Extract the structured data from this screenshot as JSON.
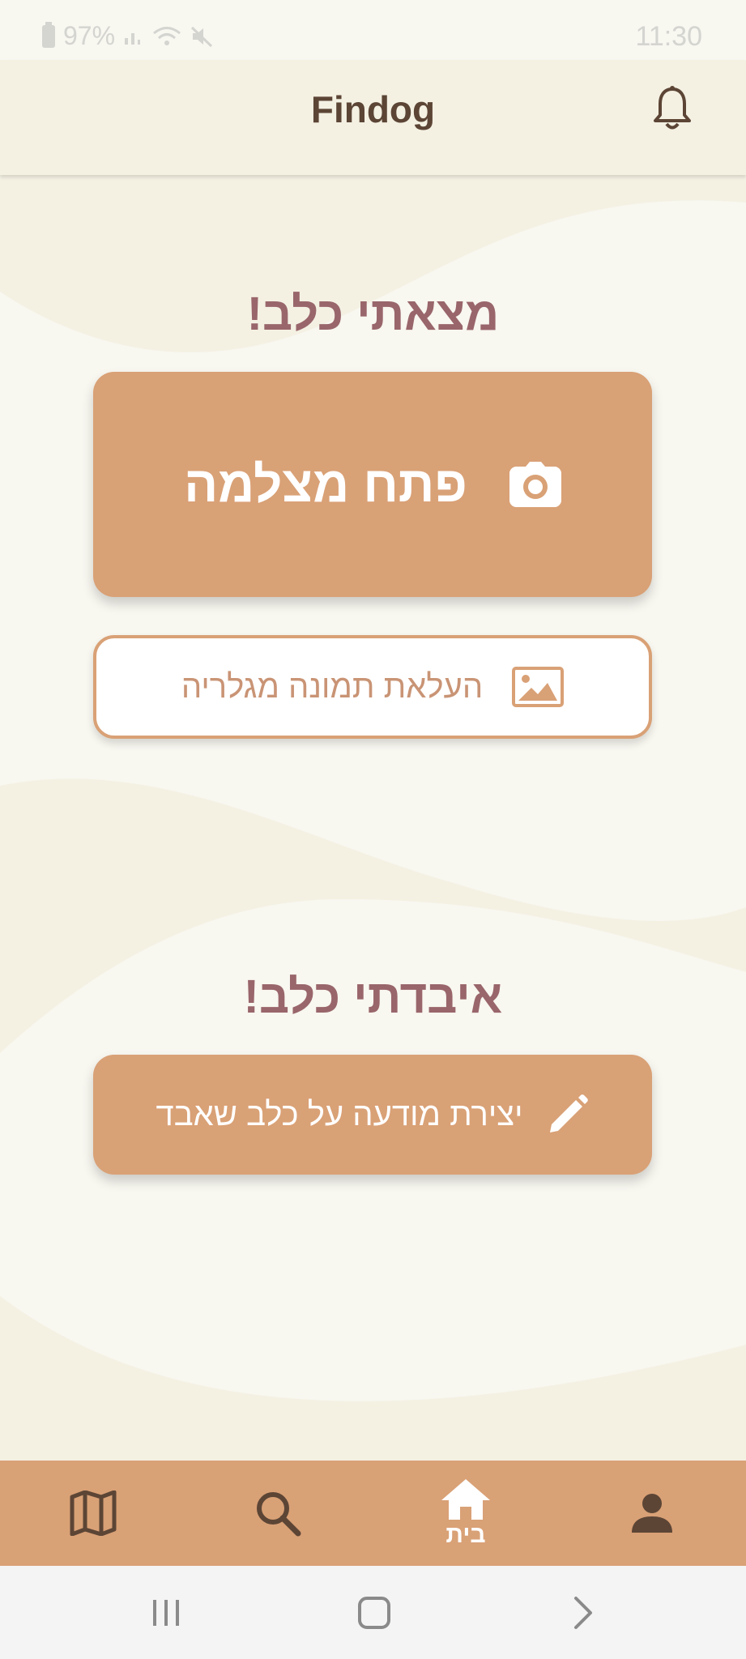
{
  "status_bar": {
    "battery": "97%",
    "time": "11:30"
  },
  "app_bar": {
    "title": "Findog",
    "bell_icon": "bell-icon"
  },
  "found_section": {
    "title": "מצאתי כלב!",
    "camera_button": {
      "label": "פתח מצלמה",
      "icon": "camera-icon"
    },
    "gallery_button": {
      "label": "העלאת תמונה מגלריה",
      "icon": "image-icon"
    }
  },
  "lost_section": {
    "title": "איבדתי כלב!",
    "create_button": {
      "label": "יצירת מודעה על כלב שאבד",
      "icon": "pencil-icon"
    }
  },
  "bottom_nav": {
    "items": [
      {
        "icon": "map-icon"
      },
      {
        "icon": "search-icon"
      },
      {
        "icon": "home-icon",
        "label": "בית",
        "active": true
      },
      {
        "icon": "person-icon"
      }
    ]
  },
  "colors": {
    "accent": "#d9a176",
    "title": "#99666b",
    "dark_brown": "#5c4535",
    "background": "#f8f7f0",
    "wave": "#f4f1e3"
  }
}
